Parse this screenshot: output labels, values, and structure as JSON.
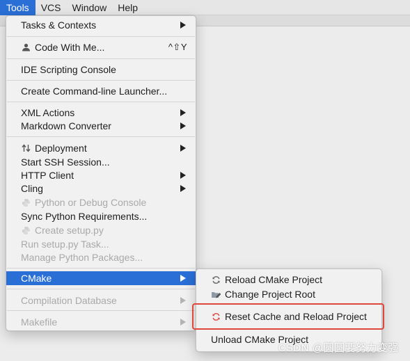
{
  "menubar": {
    "items": [
      "Tools",
      "VCS",
      "Window",
      "Help"
    ]
  },
  "tools_menu": {
    "tasks_contexts": "Tasks & Contexts",
    "code_with_me": "Code With Me...",
    "code_with_me_shortcut": "^⇧Y",
    "ide_scripting_console": "IDE Scripting Console",
    "create_command_line_launcher": "Create Command-line Launcher...",
    "xml_actions": "XML Actions",
    "markdown_converter": "Markdown Converter",
    "deployment": "Deployment",
    "start_ssh_session": "Start SSH Session...",
    "http_client": "HTTP Client",
    "cling": "Cling",
    "python_debug_console": "Python or Debug Console",
    "sync_python_requirements": "Sync Python Requirements...",
    "create_setup_py": "Create setup.py",
    "run_setup_py_task": "Run setup.py Task...",
    "manage_python_packages": "Manage Python Packages...",
    "cmake": "CMake",
    "compilation_database": "Compilation Database",
    "makefile": "Makefile"
  },
  "cmake_submenu": {
    "reload_cmake_project": "Reload CMake Project",
    "change_project_root": "Change Project Root",
    "reset_cache_reload": "Reset Cache and Reload Project",
    "unload_cmake_project": "Unload CMake Project"
  },
  "watermark": "CSDN @圆圆要努力变强",
  "colors": {
    "selection": "#2a6fd6",
    "highlight_box": "#e0463a",
    "reset_icon": "#e0463a"
  },
  "icons": {
    "code_with_me": "person-icon",
    "deployment": "up-down-arrows-icon",
    "python_console": "python-icon",
    "create_setup_py": "python-icon",
    "reload_cmake": "refresh-icon",
    "change_project_root": "folder-edit-icon",
    "reset_cache": "refresh-red-icon"
  }
}
